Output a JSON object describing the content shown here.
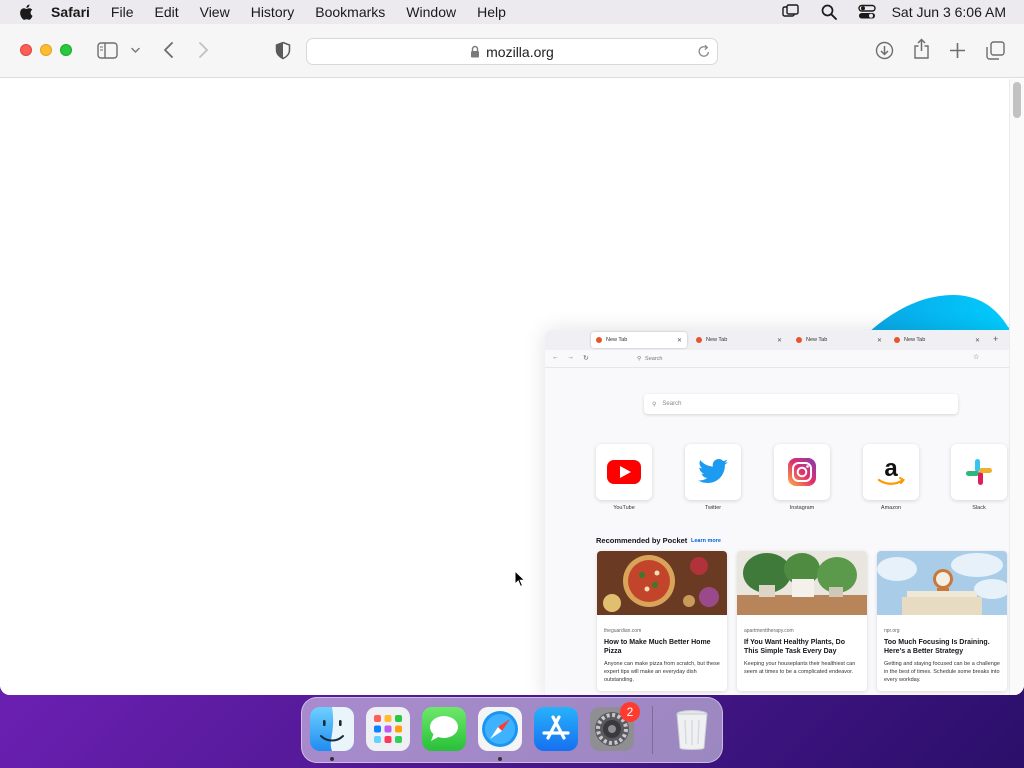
{
  "menubar": {
    "app_name": "Safari",
    "items": [
      "File",
      "Edit",
      "View",
      "History",
      "Bookmarks",
      "Window",
      "Help"
    ],
    "clock": "Sat Jun 3  6:06 AM",
    "status_icons": [
      "screen-mirroring-icon",
      "spotlight-search-icon",
      "control-center-icon"
    ]
  },
  "safari": {
    "url": "mozilla.org",
    "toolbar_icons": [
      "sidebar-icon",
      "chevron-down-icon",
      "back-arrow-icon",
      "forward-arrow-icon",
      "privacy-shield-icon",
      "lock-icon",
      "reload-icon",
      "download-icon",
      "share-icon",
      "new-tab-icon",
      "tab-overview-icon"
    ]
  },
  "firefox_preview": {
    "tabs": [
      {
        "label": "New Tab",
        "active": true
      },
      {
        "label": "New Tab",
        "active": false
      },
      {
        "label": "New Tab",
        "active": false
      },
      {
        "label": "New Tab",
        "active": false
      }
    ],
    "nav_search_placeholder": "Search",
    "search_placeholder": "Search",
    "top_sites": [
      {
        "name": "YouTube",
        "icon": "youtube-icon"
      },
      {
        "name": "Twitter",
        "icon": "twitter-icon"
      },
      {
        "name": "Instagram",
        "icon": "instagram-icon"
      },
      {
        "name": "Amazon",
        "icon": "amazon-icon"
      },
      {
        "name": "Slack",
        "icon": "slack-icon"
      }
    ],
    "pocket": {
      "heading": "Recommended by Pocket",
      "learn_more": "Learn more",
      "cards": [
        {
          "source": "theguardian.com",
          "title": "How to Make Much Better Home Pizza",
          "description": "Anyone can make pizza from scratch, but these expert tips will make an everyday dish outstanding."
        },
        {
          "source": "apartmenttherapy.com",
          "title": "If You Want Healthy Plants, Do This Simple Task Every Day",
          "description": "Keeping your houseplants their healthiest can seem at times to be a complicated endeavor."
        },
        {
          "source": "npr.org",
          "title": "Too Much Focusing Is Draining. Here's a Better Strategy",
          "description": "Getting and staying focused can be a challenge in the best of times. Schedule some breaks into every workday."
        }
      ]
    }
  },
  "dock": {
    "apps": [
      {
        "name": "Finder",
        "icon": "finder-icon",
        "running": true
      },
      {
        "name": "Launchpad",
        "icon": "launchpad-icon",
        "running": false
      },
      {
        "name": "Messages",
        "icon": "messages-icon",
        "running": false
      },
      {
        "name": "Safari",
        "icon": "safari-icon",
        "running": true
      },
      {
        "name": "App Store",
        "icon": "app-store-icon",
        "running": false
      },
      {
        "name": "System Preferences",
        "icon": "system-preferences-icon",
        "running": false,
        "badge": "2"
      },
      {
        "name": "Trash",
        "icon": "trash-icon",
        "running": false
      }
    ]
  }
}
